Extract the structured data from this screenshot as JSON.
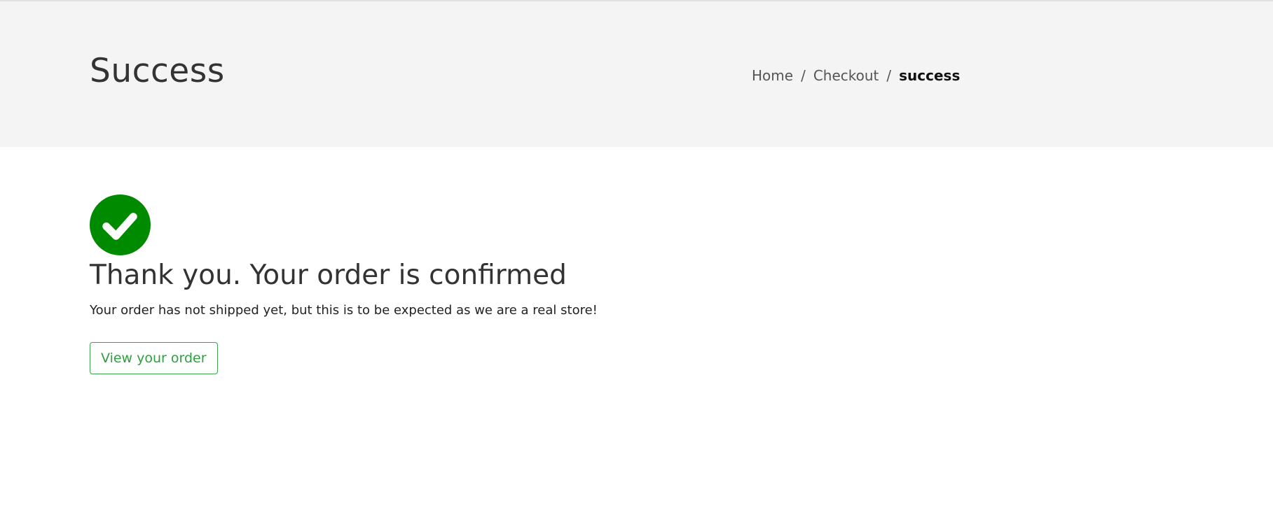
{
  "header": {
    "title": "Success",
    "breadcrumb": {
      "items": [
        {
          "label": "Home"
        },
        {
          "label": "Checkout"
        }
      ],
      "separator": "/",
      "current": "success"
    }
  },
  "confirmation": {
    "icon": "check-circle-icon",
    "icon_color": "#008a00",
    "title": "Thank you. Your order is confirmed",
    "message": "Your order has not shipped yet, but this is to be expected as we are a real store!",
    "button_label": "View your order",
    "button_color": "#3aa54a"
  }
}
